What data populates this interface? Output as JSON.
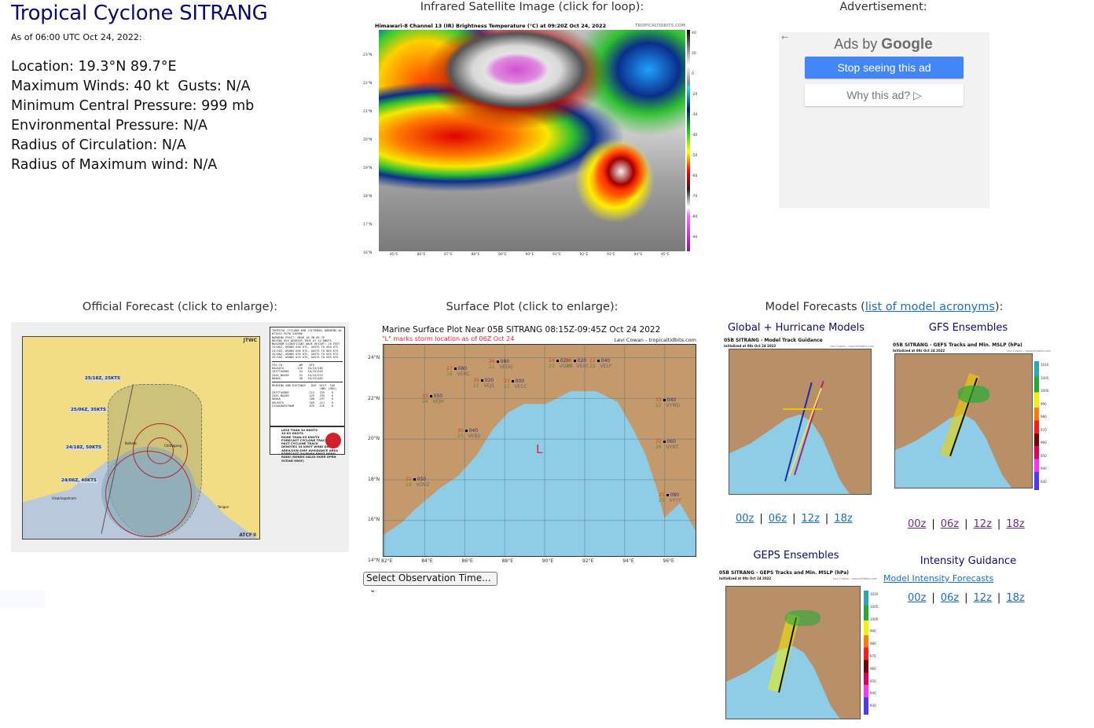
{
  "storm": {
    "title": "Tropical Cyclone SITRANG",
    "as_of": "As of 06:00 UTC Oct 24, 2022:",
    "facts": [
      "Location: 19.3°N 89.7°E",
      "Maximum Winds: 40 kt  Gusts: N/A",
      "Minimum Central Pressure: 999 mb",
      "Environmental Pressure: N/A",
      "Radius of Circulation: N/A",
      "Radius of Maximum wind: N/A"
    ]
  },
  "infrared": {
    "heading": "Infrared Satellite Image (click for loop):",
    "caption": "Himawari-8 Channel 13 (IR) Brightness Temperature (°C) at 09:20Z Oct 24, 2022",
    "brand": "TROPICALTIDBITS.COM",
    "lat_ticks": [
      "23°N",
      "22°N",
      "21°N",
      "20°N",
      "19°N",
      "18°N",
      "17°N",
      "16°N"
    ],
    "lon_ticks": [
      "85°E",
      "86°E",
      "87°E",
      "88°E",
      "89°E",
      "90°E",
      "91°E",
      "92°E",
      "93°E",
      "94°E",
      "95°E"
    ],
    "colorbar_ticks": [
      "40",
      "20",
      "0",
      "-20",
      "-30",
      "-40",
      "-50",
      "-60",
      "-70",
      "-80",
      "-90"
    ]
  },
  "ad": {
    "heading": "Advertisement:",
    "back_icon": "←",
    "ads_by": "Ads by",
    "google": "Google",
    "stop_label": "Stop seeing this ad",
    "why_label": "Why this ad? ▷"
  },
  "official": {
    "heading": "Official Forecast (click to enlarge):",
    "agency_tag": "JTWC",
    "atcf_tag": "ATCF®",
    "track_labels": [
      "25/18Z, 25KTS",
      "25/06Z, 35KTS",
      "24/18Z, 50KTS",
      "24/06Z, 40KTS"
    ],
    "warning_text": "TROPICAL CYCLONE 05B (SITRANG) WARNING #4\nWTIO31 PGTW 240900\nWARNING POSIT: NEAR 18.3N 89.7E\nMOVING 020 DEGREES TRUE AT 14 KNOTS\nMAXIMUM SIGNIFICANT WAVE HEIGHT: 18 FEET\n24/06Z, WINDS 040 KTS, GUSTS TO 050 KTS\n24/18Z, WINDS 050 KTS, GUSTS TO 065 KTS\n25/06Z, WINDS 035 KTS, GUSTS TO 045 KTS\n25/18Z, WINDS 025 KTS, GUSTS TO 035 KTS",
    "cpa_text": "CPA TO:         NM    DTG\nKOLKATA        126   10/24/18Z\nCHITTAGONG      54   10/25/03Z\nCOXS_BAZAR      42   10/24/22Z\nDHAKA           48   10/25/00Z",
    "bearing_text": "BEARING AND DISTANCE   DIR  DIST  TAU\n                            (NM) (HRS)\nCHITTAGONG            214   335    0\nCOXS_BAZAR            225   335    0\nDHAKA                 188   297    0\nKOLKATA               169   211    0\nVISAKHAPATNAM         076   376    0",
    "legend": [
      "LESS THAN 34 KNOTS",
      "34-63 KNOTS",
      "MORE THAN 63 KNOTS",
      "FORECAST CYCLONE TRACK",
      "PAST CYCLONE TRACK",
      "DENOTES 34 KNOT WIND DANGER AREA/USN SHIP AVOIDANCE AREA",
      "FORECAST 34/50/64 KNOT WIND RADII (WINDS VALID OVER OPEN OCEAN ONLY)"
    ],
    "place_labels": [
      "Kolkata",
      "Chittagong",
      "Visakhapatnam",
      "Yangon"
    ]
  },
  "surface": {
    "heading": "Surface Plot (click to enlarge):",
    "title": "Marine Surface Plot Near 05B SITRANG 08:15Z-09:45Z Oct 24 2022",
    "subtitle": "\"L\" marks storm location as of 06Z Oct 24",
    "credit": "Levi Cowan - tropicaltidbits.com",
    "storm_marker": "L",
    "lat_ticks": [
      "24°N",
      "22°N",
      "20°N",
      "18°N",
      "16°N",
      "14°N"
    ],
    "lon_ticks": [
      "82°E",
      "84°E",
      "86°E",
      "88°E",
      "90°E",
      "92°E",
      "94°E",
      "96°E"
    ],
    "stations": [
      {
        "id": "VERC",
        "temp": "27",
        "dew": "16",
        "press": "080"
      },
      {
        "id": "VEDG",
        "temp": "26",
        "dew": "21",
        "press": "080"
      },
      {
        "id": "VEJS",
        "temp": "30",
        "dew": "21",
        "press": "020"
      },
      {
        "id": "VECC",
        "temp": "23",
        "dew": "21",
        "press": "000"
      },
      {
        "id": "VGHS",
        "temp": "24",
        "dew": "23",
        "press": "020"
      },
      {
        "id": "VEAT",
        "temp": "28",
        "dew": "22",
        "press": "020"
      },
      {
        "id": "VELP",
        "temp": "22",
        "dew": "22",
        "press": "040"
      },
      {
        "id": "VEJH",
        "temp": "33",
        "dew": "24",
        "press": "050"
      },
      {
        "id": "VYMD",
        "temp": "33",
        "dew": "22",
        "press": "040"
      },
      {
        "id": "VEBS",
        "temp": "30",
        "dew": "25",
        "press": "040"
      },
      {
        "id": "VYNT",
        "temp": "32",
        "dew": "26",
        "press": "060"
      },
      {
        "id": "VOVZ",
        "temp": "31",
        "dew": "19",
        "press": "050"
      },
      {
        "id": "VYYY",
        "temp": "25",
        "dew": "25",
        "press": "080"
      }
    ],
    "select_placeholder": "Select Observation Time...",
    "select_chevron": "⌄"
  },
  "models": {
    "heading_prefix": "Model Forecasts (",
    "heading_link": "list of model acronyms",
    "heading_suffix": "):",
    "global": {
      "heading": "Global + Hurricane Models",
      "image_title": "05B SITRANG - Model Track Guidance",
      "image_init": "Initialized at 00z Oct 24 2022",
      "image_credit": "Levi Cowan - tropicaltidbits.com",
      "cycles": [
        "00z",
        "06z",
        "12z",
        "18z"
      ]
    },
    "gfs": {
      "heading": "GFS Ensembles",
      "image_title": "05B SITRANG - GEFS Tracks and Min. MSLP (hPa)",
      "image_init": "Initialized at 00z Oct 24 2022",
      "image_credit": "Levi Cowan - tropicaltidbits.com",
      "cycles": [
        "00z",
        "06z",
        "12z",
        "18z"
      ]
    },
    "geps": {
      "heading": "GEPS Ensembles",
      "image_title": "05B SITRANG - GEPS Tracks and Min. MSLP (hPa)",
      "image_init": "Initialized at 00z Oct 24 2022",
      "image_credit": "Levi Cowan - tropicaltidbits.com"
    },
    "intensity": {
      "heading": "Intensity Guidance",
      "link": "Model Intensity Forecasts",
      "cycles": [
        "00z",
        "06z",
        "12z",
        "18z"
      ]
    },
    "pressure_scale": [
      "1010",
      "1005",
      "1000",
      "990",
      "980",
      "970",
      "960",
      "950",
      "940",
      "930"
    ],
    "separator": "|"
  }
}
